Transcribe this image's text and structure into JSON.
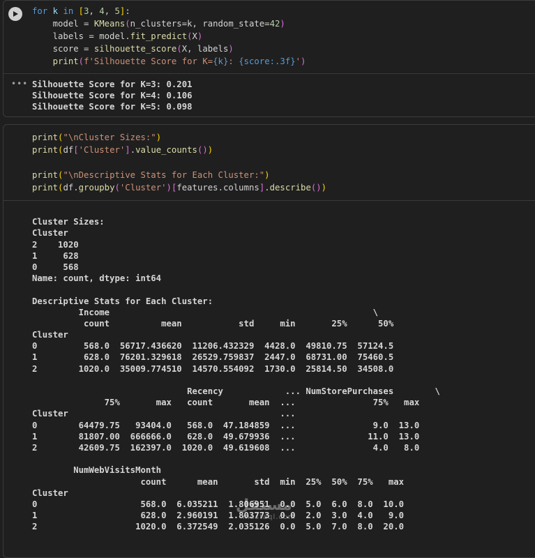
{
  "cell1": {
    "code": [
      [
        {
          "t": "for ",
          "c": "kw"
        },
        {
          "t": "k ",
          "c": "vr"
        },
        {
          "t": "in ",
          "c": "kw"
        },
        {
          "t": "[",
          "c": "br"
        },
        {
          "t": "3",
          "c": "nm"
        },
        {
          "t": ", ",
          "c": "pl"
        },
        {
          "t": "4",
          "c": "nm"
        },
        {
          "t": ", ",
          "c": "pl"
        },
        {
          "t": "5",
          "c": "nm"
        },
        {
          "t": "]",
          "c": "br"
        },
        {
          "t": ":",
          "c": "pl"
        }
      ],
      [
        {
          "t": "    model = ",
          "c": "pl"
        },
        {
          "t": "KMeans",
          "c": "fn"
        },
        {
          "t": "(",
          "c": "br2"
        },
        {
          "t": "n_clusters=k, random_state=",
          "c": "pl"
        },
        {
          "t": "42",
          "c": "nm"
        },
        {
          "t": ")",
          "c": "br2"
        }
      ],
      [
        {
          "t": "    labels = model.",
          "c": "pl"
        },
        {
          "t": "fit_predict",
          "c": "fn"
        },
        {
          "t": "(",
          "c": "br2"
        },
        {
          "t": "X",
          "c": "pl"
        },
        {
          "t": ")",
          "c": "br2"
        }
      ],
      [
        {
          "t": "    score = ",
          "c": "pl"
        },
        {
          "t": "silhouette_score",
          "c": "fn"
        },
        {
          "t": "(",
          "c": "br2"
        },
        {
          "t": "X, labels",
          "c": "pl"
        },
        {
          "t": ")",
          "c": "br2"
        }
      ],
      [
        {
          "t": "    ",
          "c": "pl"
        },
        {
          "t": "print",
          "c": "fn"
        },
        {
          "t": "(",
          "c": "br2"
        },
        {
          "t": "f'Silhouette Score for K=",
          "c": "st"
        },
        {
          "t": "{k}",
          "c": "kw"
        },
        {
          "t": ": ",
          "c": "st"
        },
        {
          "t": "{score:.3f}",
          "c": "kw"
        },
        {
          "t": "'",
          "c": "st"
        },
        {
          "t": ")",
          "c": "br2"
        }
      ]
    ],
    "output": [
      "Silhouette Score for K=3: 0.201",
      "Silhouette Score for K=4: 0.106",
      "Silhouette Score for K=5: 0.098"
    ]
  },
  "cell2": {
    "code": [
      [
        {
          "t": "print",
          "c": "fn"
        },
        {
          "t": "(",
          "c": "br"
        },
        {
          "t": "\"\\nCluster Sizes:\"",
          "c": "st"
        },
        {
          "t": ")",
          "c": "br"
        }
      ],
      [
        {
          "t": "print",
          "c": "fn"
        },
        {
          "t": "(",
          "c": "br"
        },
        {
          "t": "df",
          "c": "pl"
        },
        {
          "t": "[",
          "c": "br2"
        },
        {
          "t": "'Cluster'",
          "c": "st"
        },
        {
          "t": "]",
          "c": "br2"
        },
        {
          "t": ".",
          "c": "pl"
        },
        {
          "t": "value_counts",
          "c": "fn"
        },
        {
          "t": "()",
          "c": "br2"
        },
        {
          "t": ")",
          "c": "br"
        }
      ],
      [
        {
          "t": "",
          "c": "pl"
        }
      ],
      [
        {
          "t": "print",
          "c": "fn"
        },
        {
          "t": "(",
          "c": "br"
        },
        {
          "t": "\"\\nDescriptive Stats for Each Cluster:\"",
          "c": "st"
        },
        {
          "t": ")",
          "c": "br"
        }
      ],
      [
        {
          "t": "print",
          "c": "fn"
        },
        {
          "t": "(",
          "c": "br"
        },
        {
          "t": "df.",
          "c": "pl"
        },
        {
          "t": "groupby",
          "c": "fn"
        },
        {
          "t": "(",
          "c": "br2"
        },
        {
          "t": "'Cluster'",
          "c": "st"
        },
        {
          "t": ")",
          "c": "br2"
        },
        {
          "t": "[",
          "c": "br2"
        },
        {
          "t": "features.columns",
          "c": "pl"
        },
        {
          "t": "]",
          "c": "br2"
        },
        {
          "t": ".",
          "c": "pl"
        },
        {
          "t": "describe",
          "c": "fn"
        },
        {
          "t": "()",
          "c": "br2"
        },
        {
          "t": ")",
          "c": "br"
        }
      ]
    ],
    "output": [
      "",
      "Cluster Sizes:",
      "Cluster",
      "2    1020",
      "1     628",
      "0     568",
      "Name: count, dtype: int64",
      "",
      "Descriptive Stats for Each Cluster:",
      "         Income                                                   \\",
      "          count          mean           std     min       25%      50%",
      "Cluster",
      "0         568.0  56717.436620  11206.432329  4428.0  49810.75  57124.5",
      "1         628.0  76201.329618  26529.759837  2447.0  68731.00  75460.5",
      "2        1020.0  35009.774510  14570.554092  1730.0  25814.50  34508.0",
      "",
      "                              Recency            ... NumStorePurchases        \\",
      "              75%       max   count       mean  ...               75%   max",
      "Cluster                                         ...",
      "0        64479.75   93404.0   568.0  47.184859  ...               9.0  13.0",
      "1        81807.00  666666.0   628.0  49.679936  ...              11.0  13.0",
      "2        42609.75  162397.0  1020.0  49.619608  ...               4.0   8.0",
      "",
      "        NumWebVisitsMonth",
      "                     count      mean       std  min  25%  50%  75%   max",
      "Cluster",
      "0                    568.0  6.035211  1.806951  0.0  5.0  6.0  8.0  10.0",
      "1                    628.0  2.960191  1.803773  0.0  2.0  3.0  4.0   9.0",
      "2                   1020.0  6.372549  2.035126  0.0  5.0  7.0  8.0  20.0"
    ]
  },
  "watermark": {
    "main": "مستقل",
    "sub": "mostaql.com"
  },
  "icons": {
    "run": "play-icon",
    "output_menu": "ellipsis-icon"
  }
}
